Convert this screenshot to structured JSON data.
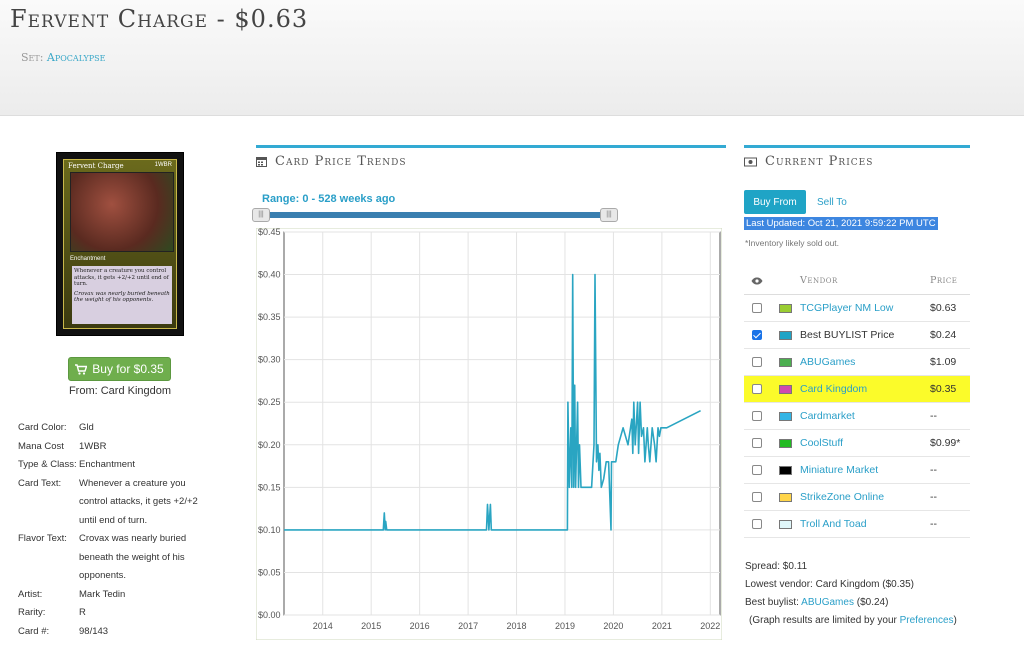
{
  "header": {
    "title": "Fervent Charge  - $0.63",
    "set_label": "Set:",
    "set_name": "Apocalypse"
  },
  "card": {
    "image": {
      "name": "Fervent Charge",
      "cost": "1WBR",
      "type": "Enchantment",
      "rules": "Whenever a creature you control attacks, it gets +2/+2 until end of turn.",
      "flavor": "Crovax was nearly buried beneath the weight of his opponents."
    },
    "buy_button": "Buy for $0.35",
    "from": "From: Card Kingdom",
    "details": [
      {
        "label": "Card Color:",
        "value": "Gld"
      },
      {
        "label": "Mana Cost",
        "value": "1WBR"
      },
      {
        "label": "Type & Class:",
        "value": "Enchantment"
      },
      {
        "label": "Card Text:",
        "value": "Whenever a creature you control attacks, it gets +2/+2 until end of turn."
      },
      {
        "label": "Flavor Text:",
        "value": "Crovax was nearly buried beneath the weight of his opponents."
      },
      {
        "label": "Artist:",
        "value": "Mark Tedin"
      },
      {
        "label": "Rarity:",
        "value": "R"
      },
      {
        "label": "Card #:",
        "value": "98/143"
      }
    ]
  },
  "trends": {
    "title": "Card Price Trends",
    "range": "Range: 0 - 528 weeks ago"
  },
  "chart_data": {
    "type": "line",
    "xlim": [
      2013.2,
      2022.2
    ],
    "ylim": [
      0,
      0.45
    ],
    "x_ticks": [
      "2014",
      "2015",
      "2016",
      "2017",
      "2018",
      "2019",
      "2020",
      "2021",
      "2022"
    ],
    "x_tick_values": [
      2014,
      2015,
      2016,
      2017,
      2018,
      2019,
      2020,
      2021,
      2022
    ],
    "y_ticks": [
      "$0.00",
      "$0.05",
      "$0.10",
      "$0.15",
      "$0.20",
      "$0.25",
      "$0.30",
      "$0.35",
      "$0.40",
      "$0.45"
    ],
    "y_tick_values": [
      0,
      0.05,
      0.1,
      0.15,
      0.2,
      0.25,
      0.3,
      0.35,
      0.4,
      0.45
    ],
    "grid": true,
    "series": [
      {
        "color": "#2aa5c2",
        "x": [
          2013.2,
          2015.25,
          2015.27,
          2015.29,
          2015.3,
          2015.32,
          2017.38,
          2017.4,
          2017.43,
          2017.46,
          2017.48,
          2019.05,
          2019.06,
          2019.09,
          2019.12,
          2019.14,
          2019.16,
          2019.18,
          2019.2,
          2019.22,
          2019.26,
          2019.28,
          2019.3,
          2019.33,
          2019.36,
          2019.45,
          2019.55,
          2019.6,
          2019.62,
          2019.65,
          2019.68,
          2019.7,
          2019.72,
          2019.75,
          2019.8,
          2019.85,
          2019.9,
          2019.95,
          2019.96,
          2019.98,
          2020.0,
          2020.05,
          2020.1,
          2020.2,
          2020.3,
          2020.38,
          2020.4,
          2020.42,
          2020.45,
          2020.5,
          2020.52,
          2020.55,
          2020.58,
          2020.62,
          2020.65,
          2020.7,
          2020.72,
          2020.75,
          2020.8,
          2020.85,
          2020.88,
          2020.92,
          2020.95,
          2020.98,
          2021.0,
          2021.05,
          2021.1,
          2021.8
        ],
        "y": [
          0.1,
          0.1,
          0.12,
          0.1,
          0.11,
          0.1,
          0.1,
          0.13,
          0.1,
          0.13,
          0.1,
          0.1,
          0.25,
          0.15,
          0.22,
          0.15,
          0.4,
          0.15,
          0.27,
          0.15,
          0.25,
          0.15,
          0.2,
          0.15,
          0.15,
          0.15,
          0.15,
          0.2,
          0.4,
          0.18,
          0.2,
          0.17,
          0.19,
          0.15,
          0.16,
          0.18,
          0.18,
          0.1,
          0.18,
          0.18,
          0.18,
          0.18,
          0.2,
          0.22,
          0.2,
          0.23,
          0.19,
          0.25,
          0.2,
          0.25,
          0.19,
          0.25,
          0.21,
          0.22,
          0.18,
          0.22,
          0.2,
          0.18,
          0.22,
          0.2,
          0.18,
          0.22,
          0.21,
          0.22,
          0.22,
          0.22,
          0.22,
          0.24
        ]
      }
    ]
  },
  "prices": {
    "title": "Current Prices",
    "buy_from": "Buy From",
    "sell_to": "Sell To",
    "last_updated": "Last Updated: Oct 21, 2021 9:59:22 PM UTC",
    "inventory_note": "*Inventory likely sold out.",
    "col_vendor": "Vendor",
    "col_price": "Price",
    "vendors": [
      {
        "name": "TCGPlayer NM Low",
        "price": "$0.63",
        "color": "#9acd32",
        "checked": false,
        "link": true,
        "highlight": false
      },
      {
        "name": "Best BUYLIST Price",
        "price": "$0.24",
        "color": "#1fa4c6",
        "checked": true,
        "link": false,
        "highlight": false
      },
      {
        "name": "ABUGames",
        "price": "$1.09",
        "color": "#4caf50",
        "checked": false,
        "link": true,
        "highlight": false
      },
      {
        "name": "Card Kingdom",
        "price": "$0.35",
        "color": "#d04ab0",
        "checked": false,
        "link": true,
        "highlight": true
      },
      {
        "name": "Cardmarket",
        "price": "--",
        "color": "#33b5e5",
        "checked": false,
        "link": true,
        "highlight": false
      },
      {
        "name": "CoolStuff",
        "price": "$0.99*",
        "color": "#22bb22",
        "checked": false,
        "link": true,
        "highlight": false
      },
      {
        "name": "Miniature Market",
        "price": "--",
        "color": "#000000",
        "checked": false,
        "link": true,
        "highlight": false
      },
      {
        "name": "StrikeZone Online",
        "price": "--",
        "color": "#ffd54a",
        "checked": false,
        "link": true,
        "highlight": false
      },
      {
        "name": "Troll And Toad",
        "price": "--",
        "color": "#e0f7fa",
        "checked": false,
        "link": true,
        "highlight": false
      }
    ],
    "spread": "Spread: $0.11",
    "lowest_vendor": "Lowest vendor: Card Kingdom ($0.35)",
    "best_buylist_prefix": "Best buylist:",
    "best_buylist_vendor": "ABUGames",
    "best_buylist_price": "($0.24)",
    "graph_note_prefix": "(Graph results are limited by your",
    "graph_note_link": "Preferences",
    "graph_note_suffix": ")"
  }
}
